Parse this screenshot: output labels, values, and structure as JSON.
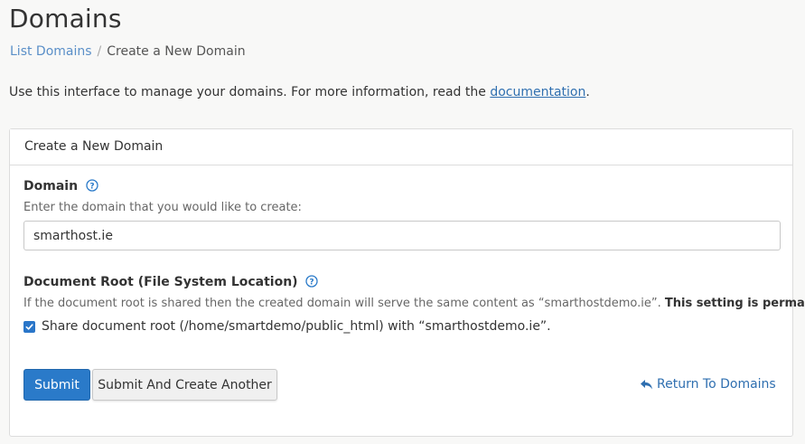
{
  "page": {
    "title": "Domains"
  },
  "breadcrumb": {
    "parent": "List Domains",
    "separator": "/",
    "current": "Create a New Domain"
  },
  "intro": {
    "text": "Use this interface to manage your domains. For more information, read the ",
    "link": "documentation",
    "suffix": "."
  },
  "panel": {
    "heading": "Create a New Domain",
    "domain": {
      "label": "Domain",
      "hint": "Enter the domain that you would like to create:",
      "value": "smarthost.ie",
      "help_icon": "question-circle-icon"
    },
    "document_root": {
      "label": "Document Root (File System Location)",
      "hint": "If the document root is shared then the created domain will serve the same content as “smarthostdemo.ie”.",
      "hint_bold": "This setting is permanent.",
      "help_icon": "question-circle-icon",
      "share_checked": true,
      "share_label": "Share document root (/home/smartdemo/public_html) with “smarthostdemo.ie”."
    },
    "actions": {
      "submit": "Submit",
      "submit_another": "Submit And Create Another",
      "return": "Return To Domains",
      "return_icon": "reply-arrow-icon"
    }
  },
  "colors": {
    "primary": "#2a7ac9",
    "link": "#2f6fb0",
    "breadcrumb_link": "#5a8fc8"
  }
}
